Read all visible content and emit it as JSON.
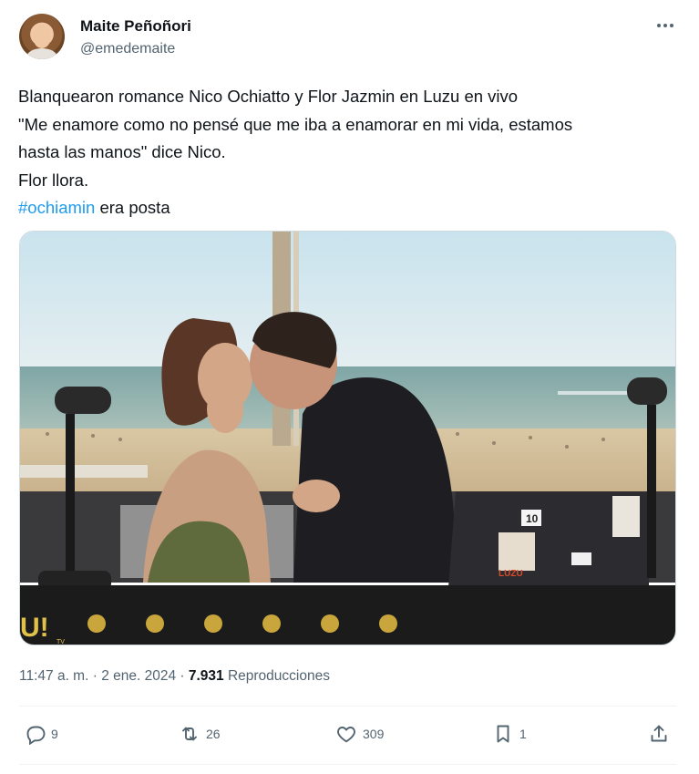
{
  "author": {
    "display_name": "Maite Peñoñori",
    "handle": "@emedemaite"
  },
  "tweet": {
    "lines": [
      "Blanquearon romance Nico Ochiatto y Flor Jazmin en Luzu en vivo",
      "\"Me enamore como no pensé que me iba a enamorar en mi vida, estamos",
      "hasta las manos\" dice Nico.",
      "Flor llora."
    ],
    "hashtag": "#ochiamin",
    "hashtag_tail": " era posta"
  },
  "media": {
    "overlay_logo": "U!",
    "overlay_logo_sub": "TV",
    "laptop_sticker_number": "10",
    "laptop_sticker_text": "LUZU"
  },
  "meta": {
    "time": "11:47 a. m.",
    "separator": " · ",
    "date": "2 ene. 2024",
    "views_count": "7.931",
    "views_label": " Reproducciones"
  },
  "actions": {
    "replies": "9",
    "retweets": "26",
    "likes": "309",
    "bookmarks": "1"
  },
  "colors": {
    "link": "#1d9bf0",
    "secondary_text": "#536471",
    "primary_text": "#0f1419"
  },
  "icons": [
    "more-icon",
    "reply-icon",
    "retweet-icon",
    "like-icon",
    "bookmark-icon",
    "share-icon"
  ]
}
